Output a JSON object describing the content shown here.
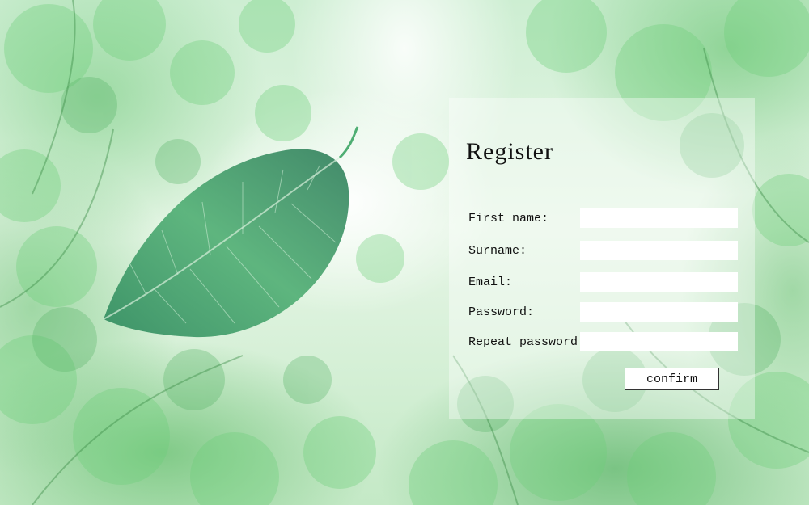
{
  "form": {
    "title": "Register",
    "fields": [
      {
        "label": "First name:",
        "value": "",
        "placeholder": ""
      },
      {
        "label": "Surname:",
        "value": "",
        "placeholder": ""
      },
      {
        "label": "Email:",
        "value": "",
        "placeholder": ""
      },
      {
        "label": "Password:",
        "value": "",
        "placeholder": ""
      },
      {
        "label": "Repeat password:",
        "value": "",
        "placeholder": ""
      }
    ],
    "confirm_label": "confirm"
  },
  "colors": {
    "panel": "#ffffff",
    "foliage": "#5cbf6a",
    "leaf": "#3f9a6a",
    "text": "#111111"
  },
  "icons": {
    "leaf": "leaf-illustration"
  }
}
